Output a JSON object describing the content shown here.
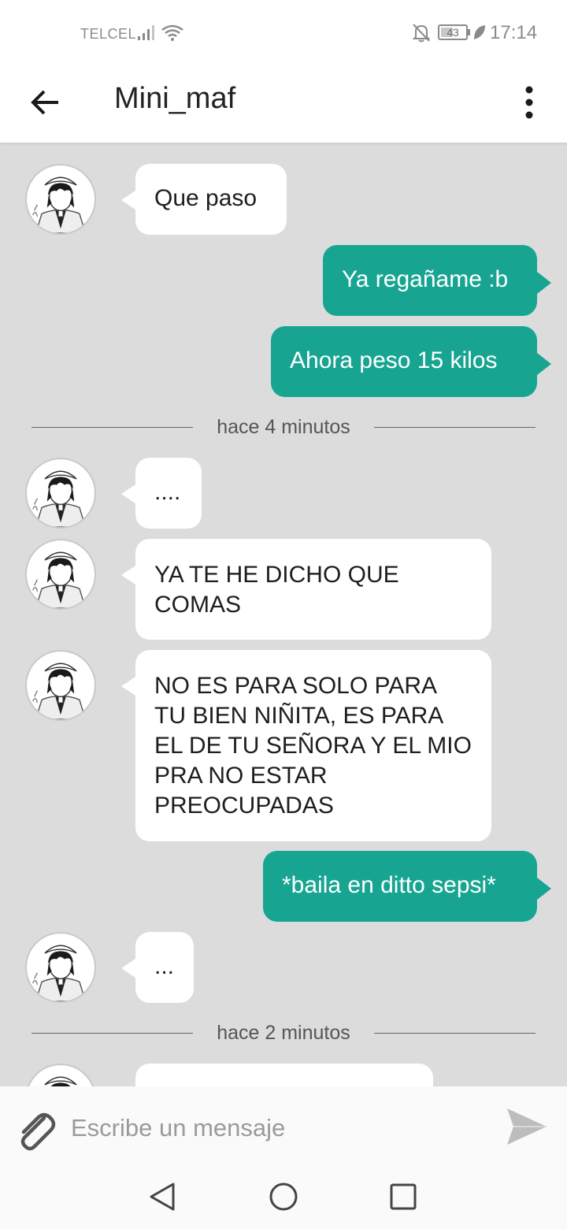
{
  "status_bar": {
    "carrier": "TELCEL",
    "battery": "43",
    "time": "17:14",
    "icons": [
      "signal-icon",
      "wifi-icon",
      "bell-off-icon",
      "battery-icon",
      "leaf-icon"
    ]
  },
  "header": {
    "title": "Mini_maf",
    "back_icon": "arrow-left-icon",
    "menu_icon": "more-vert-icon"
  },
  "messages": [
    {
      "dir": "in",
      "text": "Que paso"
    },
    {
      "dir": "out",
      "text": "Ya regañame :b"
    },
    {
      "dir": "out",
      "text": "Ahora peso 15 kilos"
    },
    {
      "divider": "hace 4 minutos"
    },
    {
      "dir": "in",
      "text": "...."
    },
    {
      "dir": "in",
      "text": "YA TE HE DICHO QUE COMAS"
    },
    {
      "dir": "in",
      "text": "NO ES PARA SOLO PARA TU BIEN NIÑITA, ES PARA EL DE TU SEÑORA Y EL MIO PRA NO ESTAR PREOCUPADAS"
    },
    {
      "dir": "out",
      "text": "*baila en ditto sepsi*"
    },
    {
      "dir": "in",
      "text": "..."
    },
    {
      "divider": "hace 2 minutos"
    },
    {
      "dir": "in",
      "text": ""
    }
  ],
  "composer": {
    "placeholder": "Escribe un mensaje",
    "value": "",
    "attach_icon": "paperclip-icon",
    "send_icon": "send-icon"
  },
  "nav": {
    "icons": [
      "back-triangle-icon",
      "home-circle-icon",
      "recents-square-icon"
    ]
  },
  "colors": {
    "background": "#dcdcdc",
    "outgoing_bubble": "#17a592",
    "incoming_bubble": "#ffffff"
  }
}
